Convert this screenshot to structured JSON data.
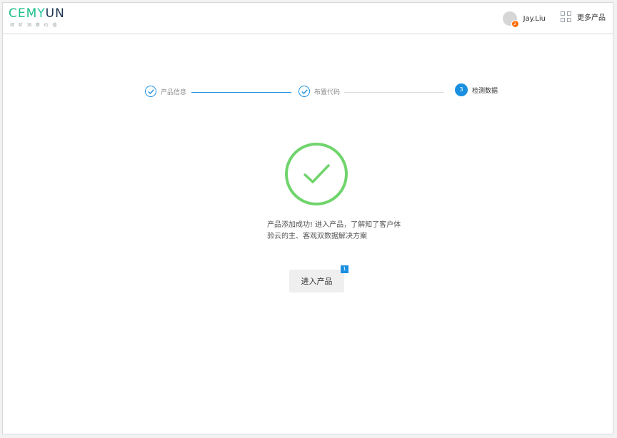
{
  "header": {
    "logo": {
      "part1": "CEM",
      "part2": "Y",
      "part3": "UN",
      "tagline": "倾 听   洞 察   价 值"
    },
    "user": {
      "name": "Jay.Liu",
      "notification_count": "2"
    },
    "more_products_label": "更多产品"
  },
  "steps": [
    {
      "label": "产品信息",
      "status": "done"
    },
    {
      "label": "布置代码",
      "status": "done"
    },
    {
      "number": "3",
      "label": "检测数据",
      "status": "active"
    }
  ],
  "result": {
    "message_line1": "产品添加成功! 进入产品，了解知了客户体",
    "message_line2": "验云的主、客观双数据解决方案",
    "button_label": "进入产品",
    "button_badge": "1"
  },
  "colors": {
    "accent": "#1a8fe0",
    "success": "#6fd46b",
    "badge_orange": "#ff6a00"
  }
}
